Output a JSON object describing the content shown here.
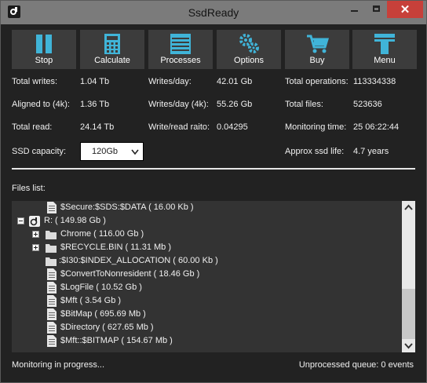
{
  "window": {
    "title": "SsdReady"
  },
  "toolbar": {
    "stop": "Stop",
    "calculate": "Calculate",
    "processes": "Processes",
    "options": "Options",
    "buy": "Buy",
    "menu": "Menu"
  },
  "stats": {
    "total_writes_label": "Total writes:",
    "total_writes": "1.04 Tb",
    "aligned_label": "Aligned to (4k):",
    "aligned": "1.36 Tb",
    "total_read_label": "Total read:",
    "total_read": "24.14 Tb",
    "writes_day_label": "Writes/day:",
    "writes_day": "42.01 Gb",
    "writes_day_4k_label": "Writes/day (4k):",
    "writes_day_4k": "55.26 Gb",
    "write_read_label": "Write/read raito:",
    "write_read": "0.04295",
    "total_ops_label": "Total operations:",
    "total_ops": "113334338",
    "total_files_label": "Total files:",
    "total_files": "523636",
    "monitoring_label": "Monitoring time:",
    "monitoring": "25 06:22:44",
    "capacity_label": "SSD capacity:",
    "capacity": "120Gb",
    "life_label": "Approx ssd life:",
    "life": "4.7 years"
  },
  "files": {
    "label": "Files list:",
    "rows": [
      "$Secure:$SDS:$DATA ( 16.00 Kb )",
      "R: ( 149.98 Gb )",
      "Chrome ( 116.00 Gb )",
      "$RECYCLE.BIN ( 11.31 Mb )",
      ":$I30:$INDEX_ALLOCATION ( 60.00 Kb )",
      "$ConvertToNonresident ( 18.46 Gb )",
      "$LogFile ( 10.52 Gb )",
      "$Mft ( 3.54 Gb )",
      "$BitMap ( 695.69 Mb )",
      "$Directory ( 627.65 Mb )",
      "$Mft::$BITMAP ( 154.67 Mb )"
    ]
  },
  "status": {
    "left": "Monitoring in progress...",
    "right": "Unprocessed queue: 0 events"
  },
  "colors": {
    "accent": "#40b4d8",
    "background": "#222222",
    "button": "#3c3c3c"
  }
}
